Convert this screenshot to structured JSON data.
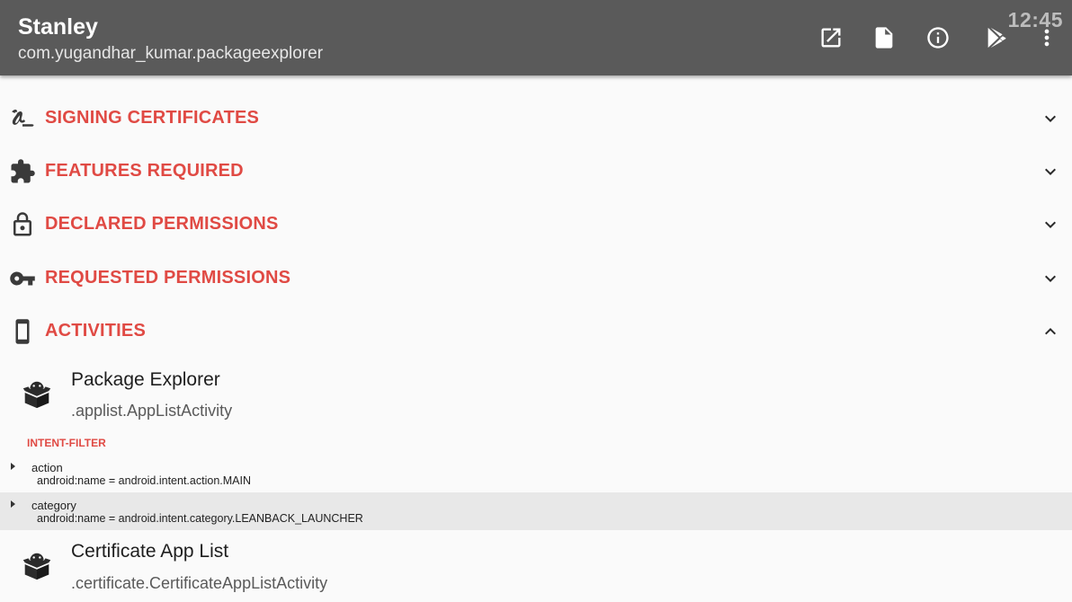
{
  "appbar": {
    "title": "Stanley",
    "subtitle": "com.yugandhar_kumar.packageexplorer",
    "clock": "12:45",
    "actions": [
      {
        "name": "open-in-new-icon"
      },
      {
        "name": "document-icon"
      },
      {
        "name": "info-icon"
      },
      {
        "name": "play-store-icon"
      },
      {
        "name": "more-vert-icon"
      }
    ]
  },
  "sections": [
    {
      "label": "SIGNING CERTIFICATES",
      "icon": "signature-icon",
      "state": "collapsed"
    },
    {
      "label": "FEATURES REQUIRED",
      "icon": "puzzle-icon",
      "state": "collapsed"
    },
    {
      "label": "DECLARED PERMISSIONS",
      "icon": "lock-icon",
      "state": "collapsed"
    },
    {
      "label": "REQUESTED PERMISSIONS",
      "icon": "key-icon",
      "state": "collapsed"
    },
    {
      "label": "ACTIVITIES",
      "icon": "phone-icon",
      "state": "expanded"
    }
  ],
  "activities": [
    {
      "name": "Package Explorer",
      "class_name": ".applist.AppListActivity",
      "icon": "package-box-icon",
      "intent_filter": {
        "header": "INTENT-FILTER",
        "items": [
          {
            "tag": "action",
            "attr": "android:name = android.intent.action.MAIN"
          },
          {
            "tag": "category",
            "attr": "android:name = android.intent.category.LEANBACK_LAUNCHER"
          }
        ]
      }
    },
    {
      "name": "Certificate App List",
      "class_name": ".certificate.CertificateAppListActivity",
      "icon": "package-box-icon"
    }
  ],
  "colors": {
    "appbar": "#5a5a5a",
    "accent": "#e04a44",
    "background": "#fafafa",
    "highlight_row": "#e8e8e8"
  }
}
